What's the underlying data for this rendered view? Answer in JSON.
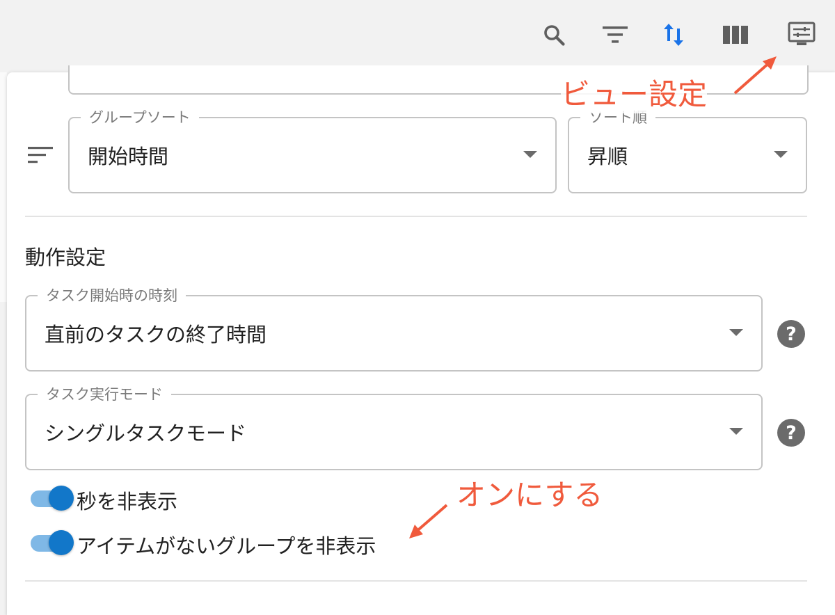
{
  "toolbar": {
    "icons": [
      "search-icon",
      "filter-list-icon",
      "sort-arrows-icon",
      "view-columns-icon",
      "view-settings-icon"
    ],
    "active_color": "#1a73e8",
    "icon_color": "#5f5f5f"
  },
  "sort_section": {
    "group_sort": {
      "legend": "グループソート",
      "value": "開始時間"
    },
    "sort_order": {
      "legend": "ソート順",
      "value": "昇順"
    }
  },
  "behavior": {
    "title": "動作設定",
    "task_start_time": {
      "legend": "タスク開始時の時刻",
      "value": "直前のタスクの終了時間"
    },
    "task_run_mode": {
      "legend": "タスク実行モード",
      "value": "シングルタスクモード"
    },
    "help_glyph": "?",
    "toggles": [
      {
        "label": "秒を非表示",
        "on": true
      },
      {
        "label": "アイテムがないグループを非表示",
        "on": true
      }
    ]
  },
  "annotations": {
    "view_settings": "ビュー設定",
    "turn_on": "オンにする",
    "color": "#f05a3c"
  },
  "colors": {
    "toggle_thumb": "#1277c9",
    "toggle_track": "#7fb8e6"
  }
}
